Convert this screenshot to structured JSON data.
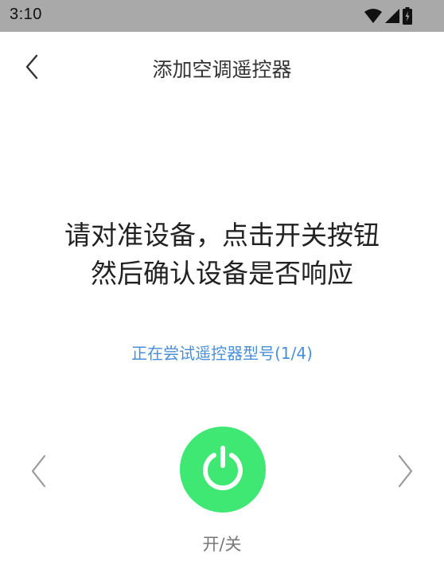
{
  "status_bar": {
    "time": "3:10",
    "icons": [
      "wifi-icon",
      "cell-signal-icon",
      "battery-icon"
    ]
  },
  "header": {
    "title": "添加空调遥控器",
    "back_icon": "chevron-left-icon"
  },
  "instruction": {
    "line1": "请对准设备，点击开关按钮",
    "line2": "然后确认设备是否响应"
  },
  "progress": {
    "text": "正在尝试遥控器型号(1/4)"
  },
  "controls": {
    "prev_icon": "chevron-left-icon",
    "next_icon": "chevron-right-icon",
    "power_icon": "power-icon",
    "power_label": "开/关"
  },
  "colors": {
    "status_bar": "#a9a9a9",
    "accent_blue": "#4a90d9",
    "power_green": "#3ee873"
  }
}
